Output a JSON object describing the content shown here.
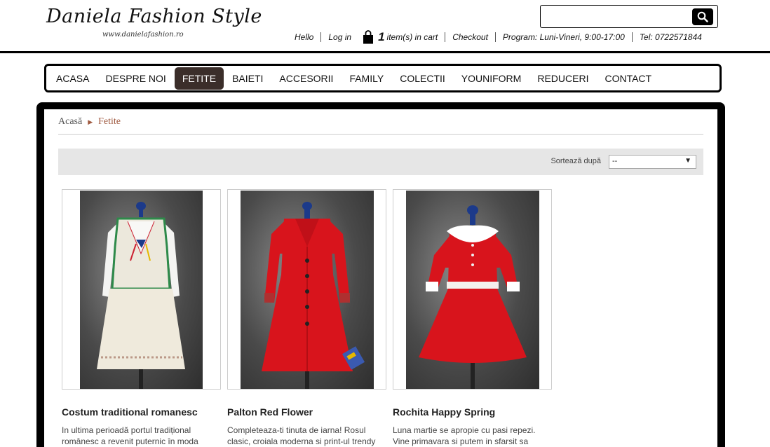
{
  "brand": {
    "logo_text": "Daniela Fashion Style",
    "logo_url": "www.danielafashion.ro"
  },
  "search": {
    "placeholder": ""
  },
  "toplinks": {
    "hello": "Hello",
    "login": "Log in",
    "cart_count": "1",
    "cart_label": "item(s) in cart",
    "checkout": "Checkout",
    "program": "Program: Luni-Vineri, 9:00-17:00",
    "phone": "Tel: 0722571844"
  },
  "nav": {
    "items": [
      "ACASA",
      "DESPRE NOI",
      "FETITE",
      "BAIETI",
      "ACCESORII",
      "FAMILY",
      "COLECTII",
      "YOUNIFORM",
      "REDUCERI",
      "CONTACT"
    ],
    "active": "FETITE"
  },
  "breadcrumb": {
    "home": "Acasă",
    "current": "Fetite"
  },
  "sort": {
    "label": "Sortează după",
    "selected": "--"
  },
  "products": [
    {
      "name": "Costum traditional romanesc",
      "description": "In ultima perioadă portul tradițional românesc a revenit puternic în moda",
      "icon": "traditional-costume"
    },
    {
      "name": "Palton Red Flower",
      "description": "Completeaza-ti tinuta de iarna! Rosul clasic, croiala moderna si print-ul trendy",
      "icon": "red-coat"
    },
    {
      "name": "Rochita Happy Spring",
      "description": "Luna martie se apropie cu pasi repezi. Vine primavara si putem in sfarsit sa",
      "icon": "red-dress"
    }
  ],
  "colors": {
    "nav_active_bg": "#3b2e2a",
    "breadcrumb_accent": "#a05a40",
    "product_red": "#d8141c",
    "sortbar_bg": "#e6e6e6"
  }
}
